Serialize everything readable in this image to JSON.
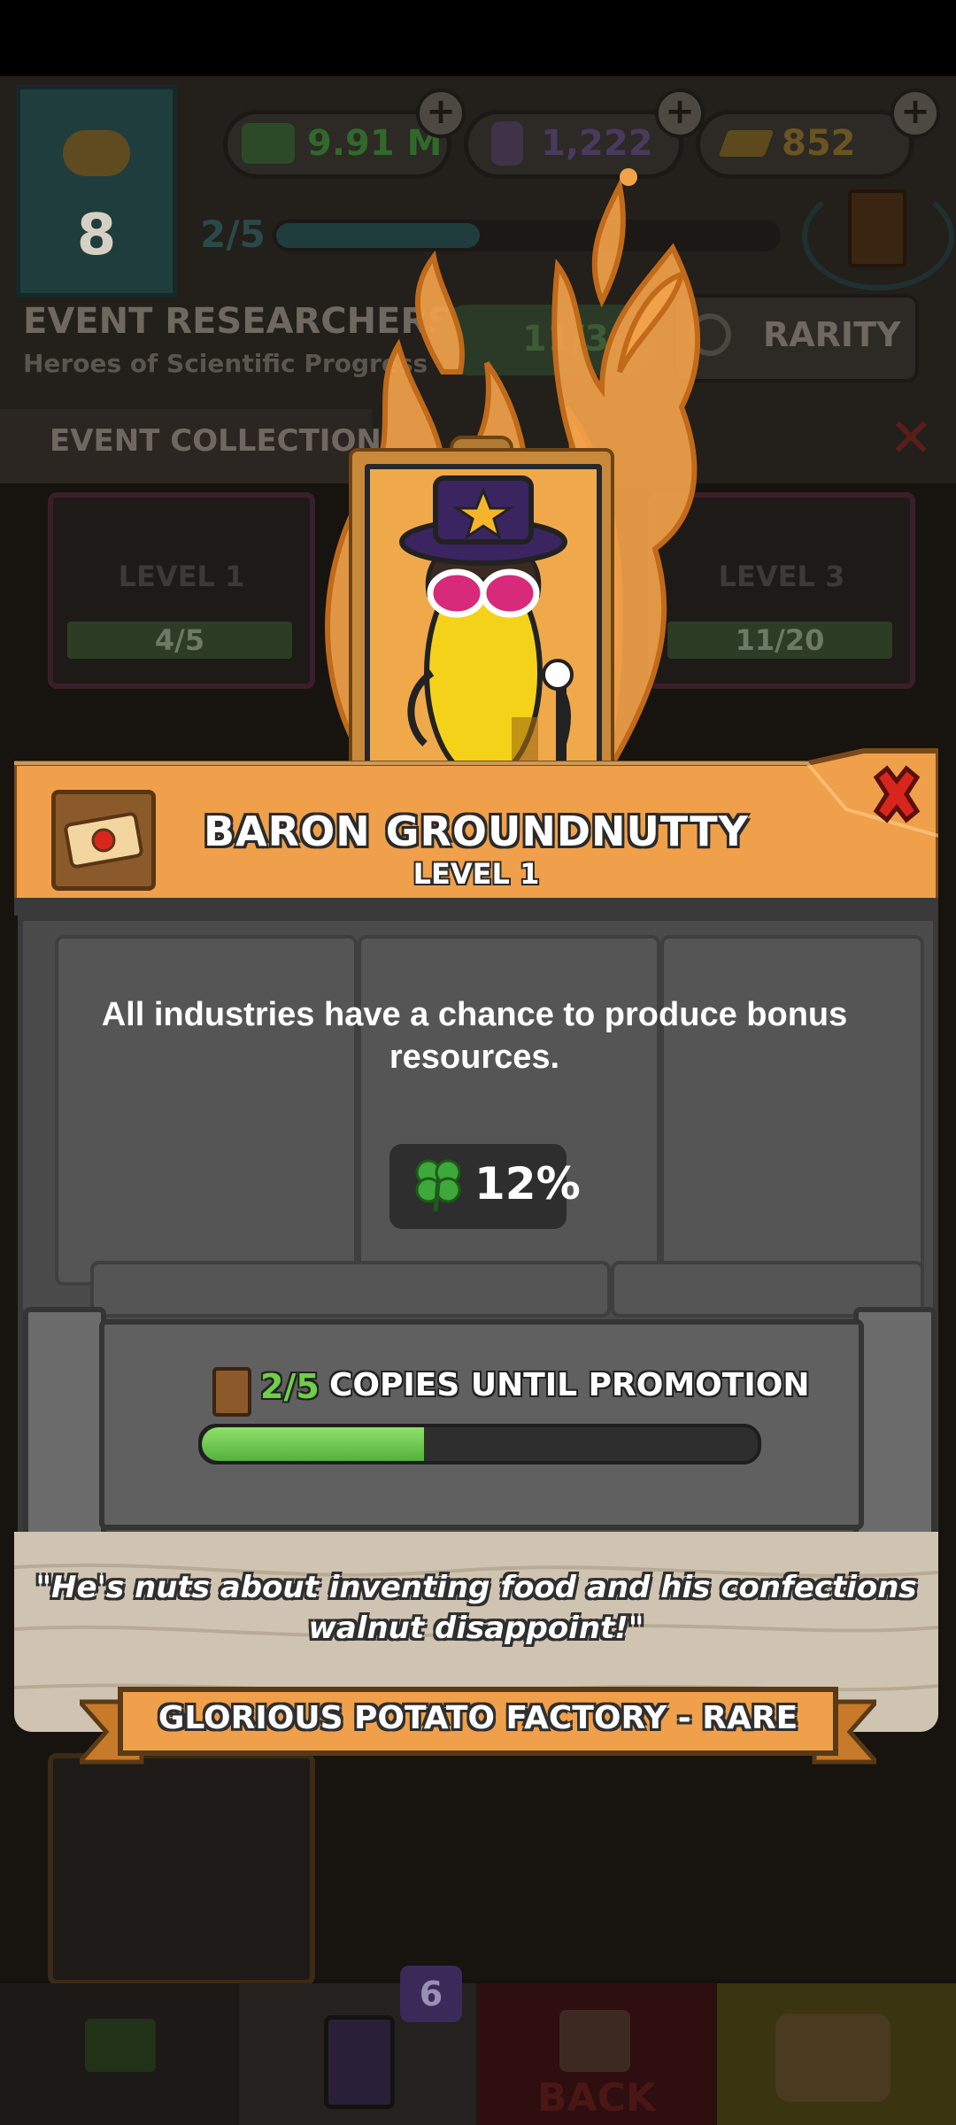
{
  "background": {
    "resources": [
      {
        "name": "cash",
        "value": "9.91 M",
        "color": "#2f6a2a"
      },
      {
        "name": "potion",
        "value": "1,222",
        "color": "#4a3a5e"
      },
      {
        "name": "gold-bars",
        "value": "852",
        "color": "#6a5420"
      }
    ],
    "event_level": "8",
    "event_progress": "2/5",
    "event_title": "EVENT RESEARCHERS",
    "event_subtitle": "Heroes of Scientific Progress",
    "collection_count": "11/3",
    "rarity_label": "RARITY",
    "collection_label": "EVENT COLLECTION",
    "cards": [
      {
        "level": "LEVEL 1",
        "progress": "4/5"
      },
      {
        "level": "LEVEL 3",
        "progress": "11/20"
      }
    ],
    "nav_badge": "6",
    "nav_back_label": "BACK"
  },
  "researcher": {
    "name": "BARON GROUNDNUTTY",
    "level": "LEVEL 1",
    "description": "All industries have a chance to produce bonus resources.",
    "bonus_value": "12%",
    "copies": "2/5",
    "copies_label": "COPIES UNTIL PROMOTION",
    "copies_progress": 0.4,
    "quote": "\"He's nuts about inventing food and his confections walnut disappoint!\"",
    "footer": "GLORIOUS POTATO FACTORY - RARE"
  },
  "colors": {
    "header_orange": "#f0a04a",
    "progress_green": "#6fd048",
    "close_red": "#d8261e",
    "flame_orange": "#f2a24a"
  }
}
